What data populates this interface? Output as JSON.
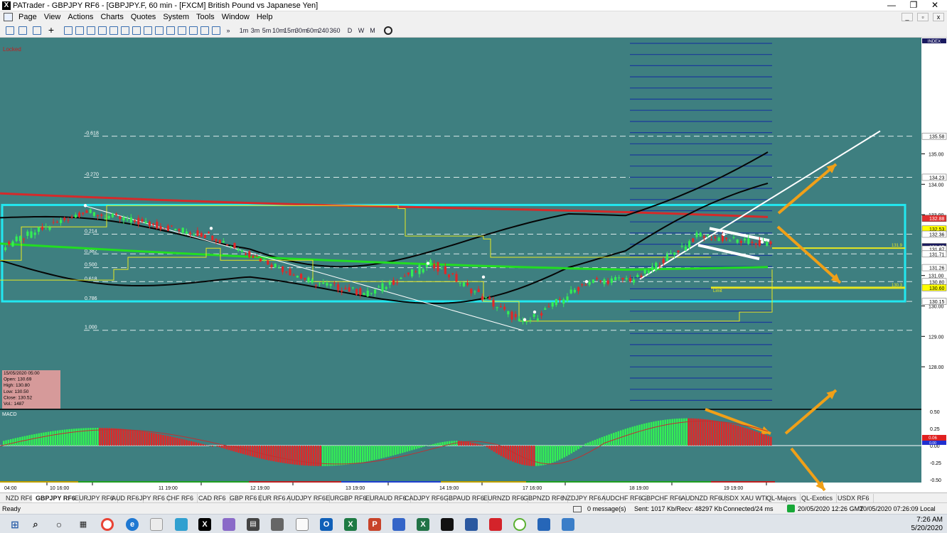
{
  "window": {
    "app_icon": "X",
    "title": "PATrader - GBPJPY RF6 - [GBPJPY.F, 60 min - [FXCM] British Pound vs Japanese Yen]",
    "minimize": "—",
    "restore": "❐",
    "close": "✕"
  },
  "menu": [
    "Page",
    "View",
    "Actions",
    "Charts",
    "Quotes",
    "System",
    "Tools",
    "Window",
    "Help"
  ],
  "toolbar": {
    "timeframes": [
      "1m",
      "3m",
      "5m",
      "10m",
      "15m",
      "30m",
      "60m",
      "240",
      "360",
      "D",
      "W",
      "M"
    ],
    "overflow": "»"
  },
  "chart": {
    "locked_label": "Locked",
    "index_label": "INDEX",
    "fib_levels": [
      {
        "label": "-0.618"
      },
      {
        "label": "-0.270"
      },
      {
        "label": "0.214"
      },
      {
        "label": "0.382"
      },
      {
        "label": "0.500"
      },
      {
        "label": "0.618"
      },
      {
        "label": "0.786"
      },
      {
        "label": "1.000"
      }
    ],
    "price_axis_ticks": [
      "135.00",
      "134.00",
      "133.00",
      "131.00",
      "130.00",
      "129.00",
      "128.00"
    ],
    "price_axis_boxes": [
      {
        "label": "135.58",
        "color": "#ffffff"
      },
      {
        "label": "134.23",
        "color": "#ffffff"
      },
      {
        "label": "132.88",
        "color": "#e03030"
      },
      {
        "label": "132.53",
        "color": "#ffff00"
      },
      {
        "label": "132.36",
        "color": "#ffffff"
      },
      {
        "label": "131.95",
        "color": "#1a1a60"
      },
      {
        "label": "131.87",
        "color": "#ffffff"
      },
      {
        "label": "131.71",
        "color": "#ffffff"
      },
      {
        "label": "131.26",
        "color": "#ffffff"
      },
      {
        "label": "130.80",
        "color": "#ffffff"
      },
      {
        "label": "130.60",
        "color": "#ffff00"
      },
      {
        "label": "130.15",
        "color": "#ffffff"
      }
    ],
    "inline_labels": {
      "upper_line": "131.9",
      "lower_line": "130.3",
      "limit": "Limit"
    },
    "time_axis": [
      "04:00",
      "10 16:00",
      "11 19:00",
      "12 19:00",
      "13 19:00",
      "14 19:00",
      "17 16:00",
      "18 19:00",
      "19 19:00"
    ],
    "ohlc": {
      "date": "15/05/2020 05:00",
      "open": "Open: 130.69",
      "high": "High: 130.80",
      "low": "Low: 130.50",
      "close": "Close: 130.52",
      "vol": "Vol.: 1487"
    },
    "macd": {
      "label": "MACD",
      "ticks": [
        "0.50",
        "0.25",
        "0.00",
        "-0.25",
        "-0.50"
      ],
      "value_boxes": [
        "0.06",
        "0.00"
      ]
    },
    "colors": {
      "background": "#3e7f80",
      "bull": "#33ee55",
      "bear": "#e02828",
      "cyan_box": "#22e8f0",
      "yellow": "#e8e820",
      "red_ma": "#d42a2a",
      "green_ma": "#22dd22",
      "arrows": "#f0a018"
    }
  },
  "tabs": [
    "NZD RF6",
    "GBPJPY RF6",
    "EURJPY RF6",
    "AUD RF6",
    "JPY RF6",
    "CHF RF6",
    "CAD RF6",
    "GBP RF6",
    "EUR RF6",
    "AUDJPY RF6",
    "EURGBP RF6",
    "EURAUD RF6",
    "CADJPY RF6",
    "GBPAUD RF6",
    "EURNZD RF6",
    "GBPNZD RF6",
    "NZDJPY RF6",
    "AUDCHF RF6",
    "GBPCHF RF6",
    "AUDNZD RF6",
    "USDX XAU WTI",
    "QL-Majors",
    "QL-Exotics",
    "USDX RF6"
  ],
  "status": {
    "ready": "Ready",
    "messages": "0 message(s)",
    "traffic": "Sent: 1017 Kb/Recv: 48297 Kb",
    "connection": "Connected/24 ms",
    "time_gmt": "20/05/2020 12:26 GMT",
    "time_local": "20/05/2020 07:26:09 Local"
  },
  "taskbar": {
    "time": "7:26 AM",
    "date": "5/20/2020"
  }
}
